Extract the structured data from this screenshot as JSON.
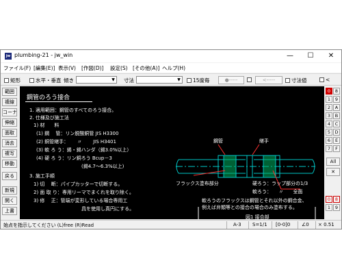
{
  "window": {
    "icon_text": "jw",
    "title": "plumbing-21 - jw_win",
    "minimize_glyph": "—",
    "maximize_glyph": "☐",
    "close_glyph": "✕"
  },
  "menu": [
    "ファイル(F)",
    "[編集(E)]",
    "表示(V)",
    "[作図(D)]",
    "設定(S)",
    "[その他(A)]",
    "ヘルプ(H)"
  ],
  "toolbar": {
    "rect_label": "矩形",
    "hv_label": "水平・垂直",
    "angle_label": "傾き",
    "dim_label": "寸法",
    "deg15_label": "15度毎",
    "dots_label": "●-----",
    "arrow_label": "<-----",
    "dimval_label": "寸法値",
    "lt_label": "<"
  },
  "left_buttons": [
    "範囲",
    "複線",
    "コーナー",
    "伸縮",
    "面取",
    "消去",
    "複写",
    "移動",
    "戻る",
    "新規",
    "開く",
    "上書"
  ],
  "right_buttons": {
    "grid": [
      [
        "0",
        "8"
      ],
      [
        "1",
        "9"
      ],
      [
        "2",
        "A"
      ],
      [
        "3",
        "B"
      ],
      [
        "4",
        "C"
      ],
      [
        "5",
        "D"
      ],
      [
        "6",
        "E"
      ],
      [
        "7",
        "F"
      ]
    ],
    "all": "All",
    "x": "✕",
    "bottom": [
      [
        "0",
        "8"
      ],
      [
        "1",
        "9"
      ]
    ]
  },
  "drawing": {
    "title": "鋼管のろう接合",
    "lines": [
      "1. 適用範囲：鋼管のすべてのろう接合。",
      "2. 仕様及び施工法",
      "1) 材　　料",
      "(1) 鋼　 管：リン脱酸銅管 JIS H3300",
      "(2) 銅管継手：　　 〃　　 JIS H3401",
      "(3) 軟 ろ う：錫・錫ハンダ（錫3.0%以上）",
      "(4) 硬 ろ う：リン銅ろう Bcup－3",
      "(錫4.7～6.3%以上)",
      "3. 施工手順",
      "1) 切　 断：パイプカッターで切断する。",
      "2) 面 取 り：専用リーマでまくれを取り除く。",
      "3) 修　 正：管端が変形している場合専用工",
      "具を使用し真円にする。"
    ],
    "label_pipe": "鋼管",
    "label_fitting": "継手",
    "label_flux": "フラックス塗布部分",
    "label_hard": "硬ろう：ラップ部分の1/3",
    "label_soft": "軟ろう：　　〃　　全面",
    "note_1": "軟ろうのフラックスは鋼管とそれ以外の鋼合金、",
    "note_2": "例えば弁類等との接合の場合のみ塗布する。",
    "figure_caption": "図1 接合部"
  },
  "status": {
    "message": "始点を指示してください (L)free (R)Read",
    "paper": "A-3",
    "scale": "S=1/1",
    "layer": "[0-0]0",
    "angle": "∠0",
    "zoom": "× 0.51"
  },
  "colors": {
    "canvas_bg": "#000000",
    "pipe": "#00c8c8",
    "flux": "#00b060",
    "leader": "#ff3030",
    "accent_red": "#d00000"
  }
}
